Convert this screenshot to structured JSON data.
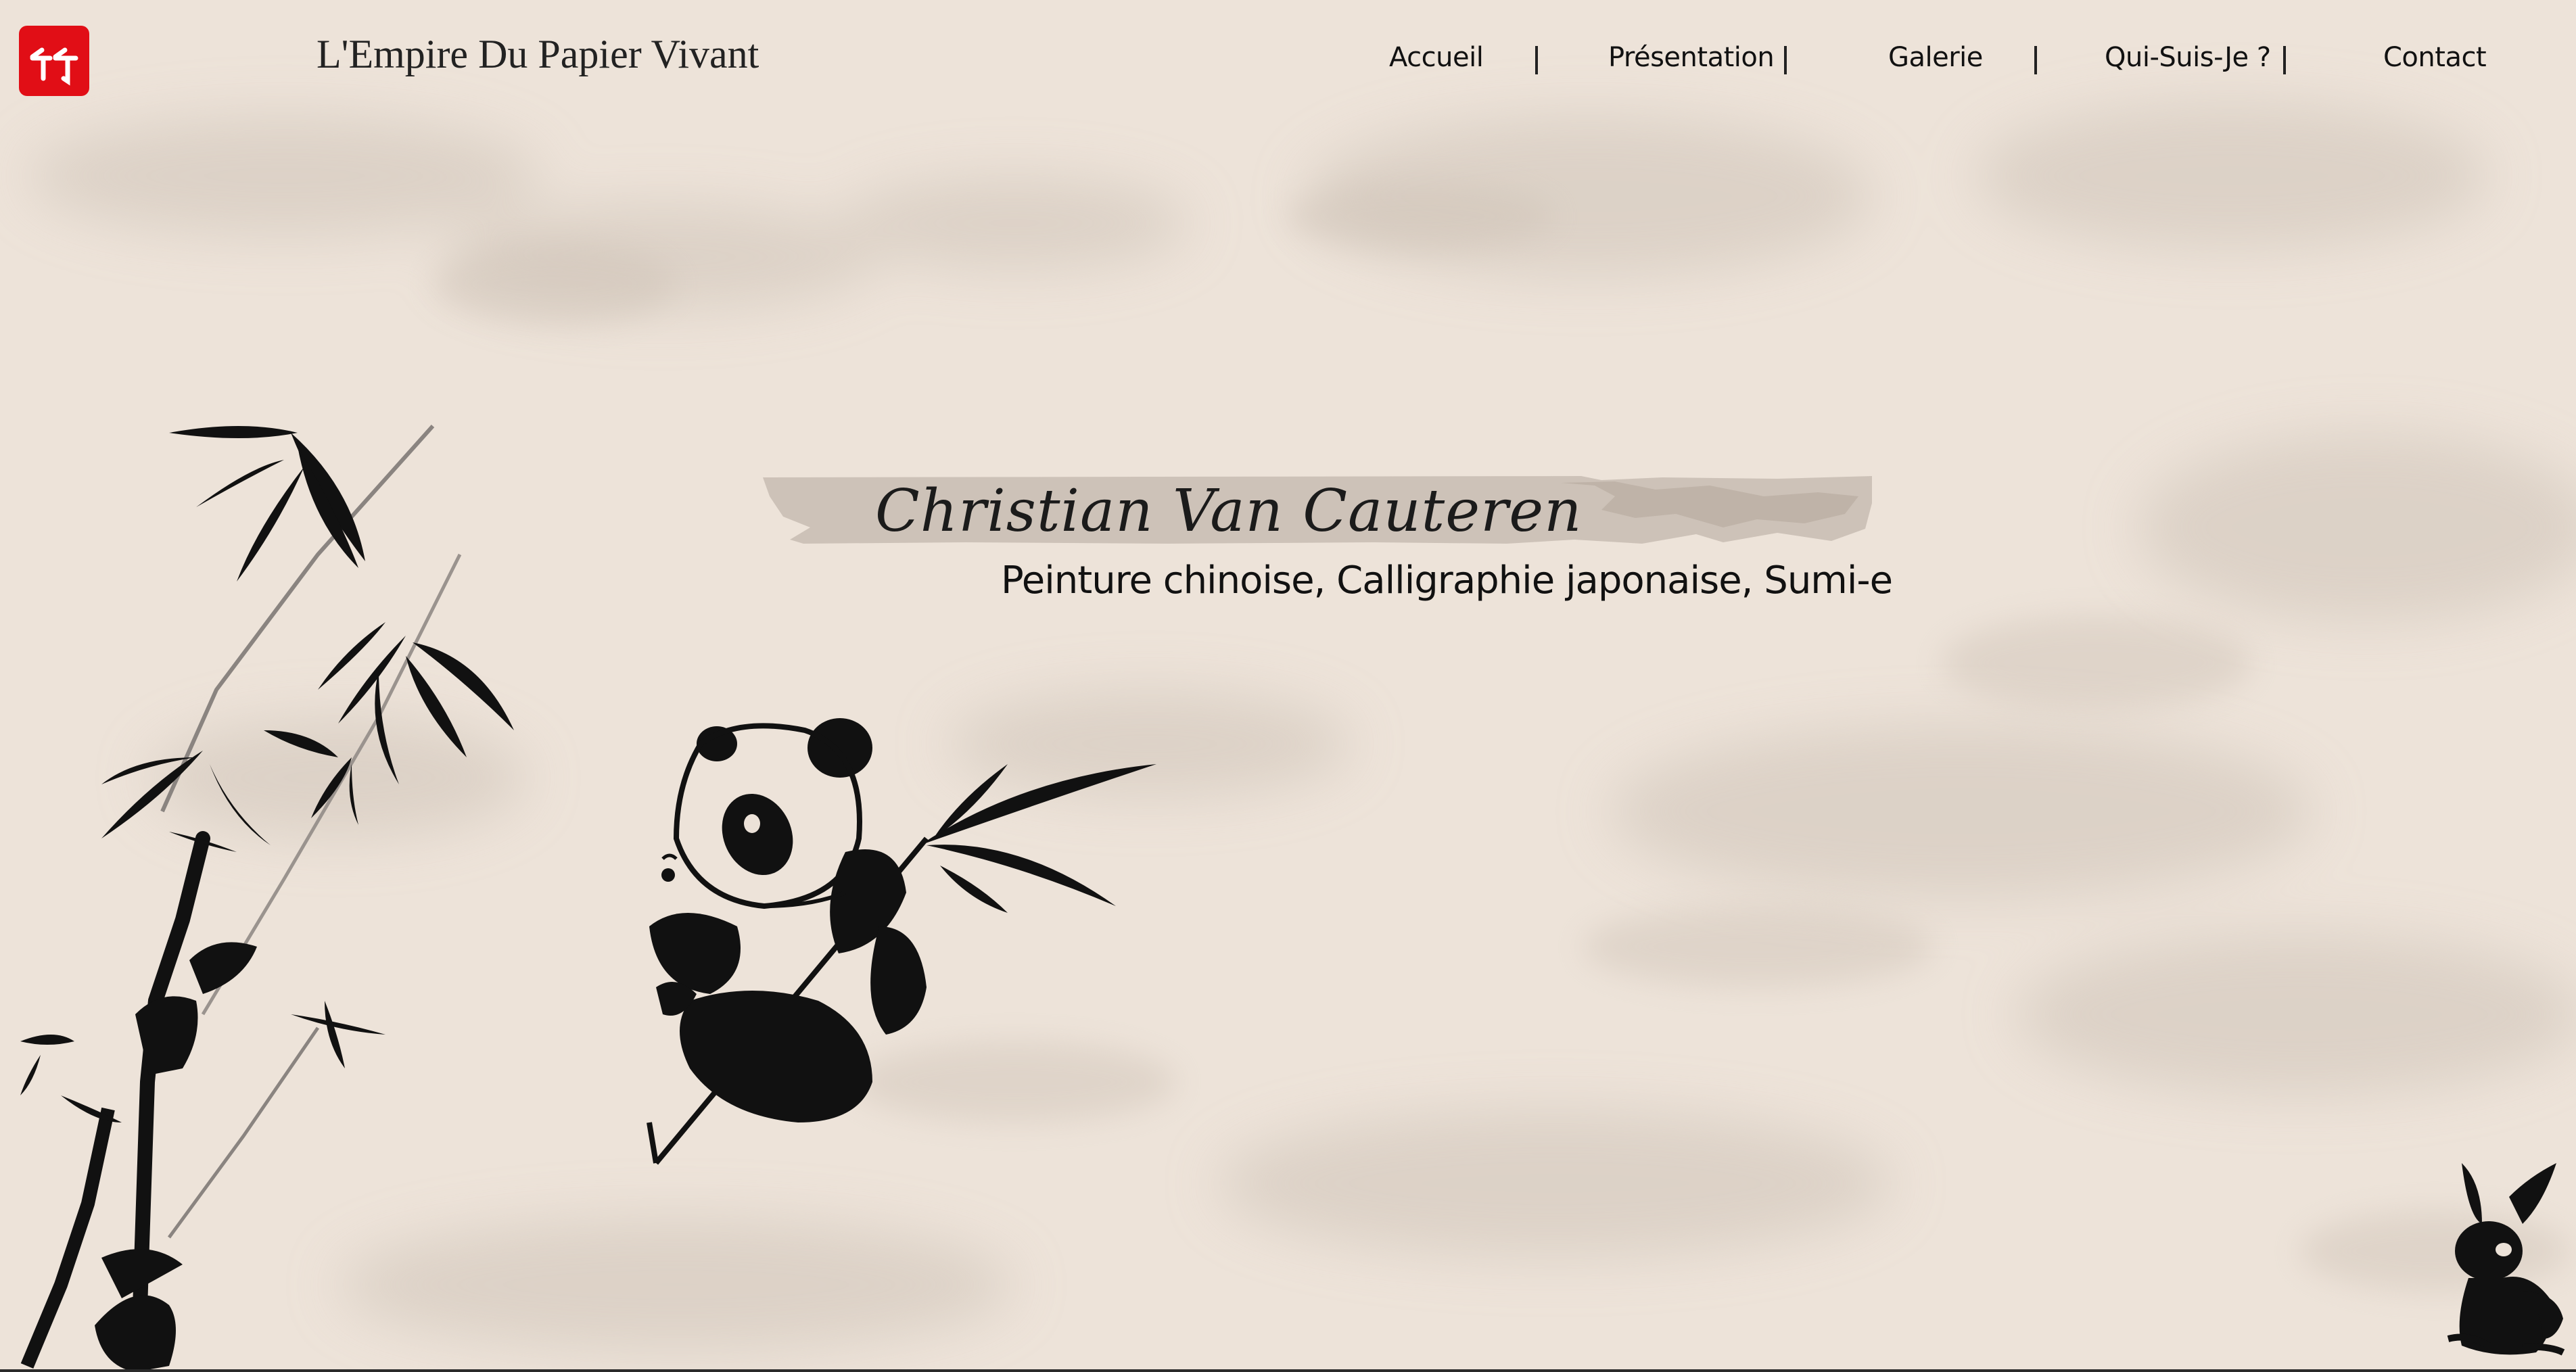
{
  "header": {
    "logo_icon": "bamboo-kanji-icon",
    "logo_color": "#e10e16",
    "site_title": "L'Empire Du Papier Vivant"
  },
  "nav": {
    "items": [
      {
        "label": "Accueil"
      },
      {
        "label": "Présentation"
      },
      {
        "label": "Galerie"
      },
      {
        "label": "Qui-Suis-Je ?"
      },
      {
        "label": "Contact"
      }
    ]
  },
  "hero": {
    "name": "Christian Van Cauteren",
    "subtitle": "Peinture chinoise, Calligraphie japonaise, Sumi-e"
  },
  "illustrations": {
    "left": "bamboo-icon",
    "center": "panda-icon",
    "bottom_right": "rabbit-icon"
  },
  "colors": {
    "background": "#ece2d8",
    "ink": "#111111",
    "accent": "#e10e16"
  }
}
